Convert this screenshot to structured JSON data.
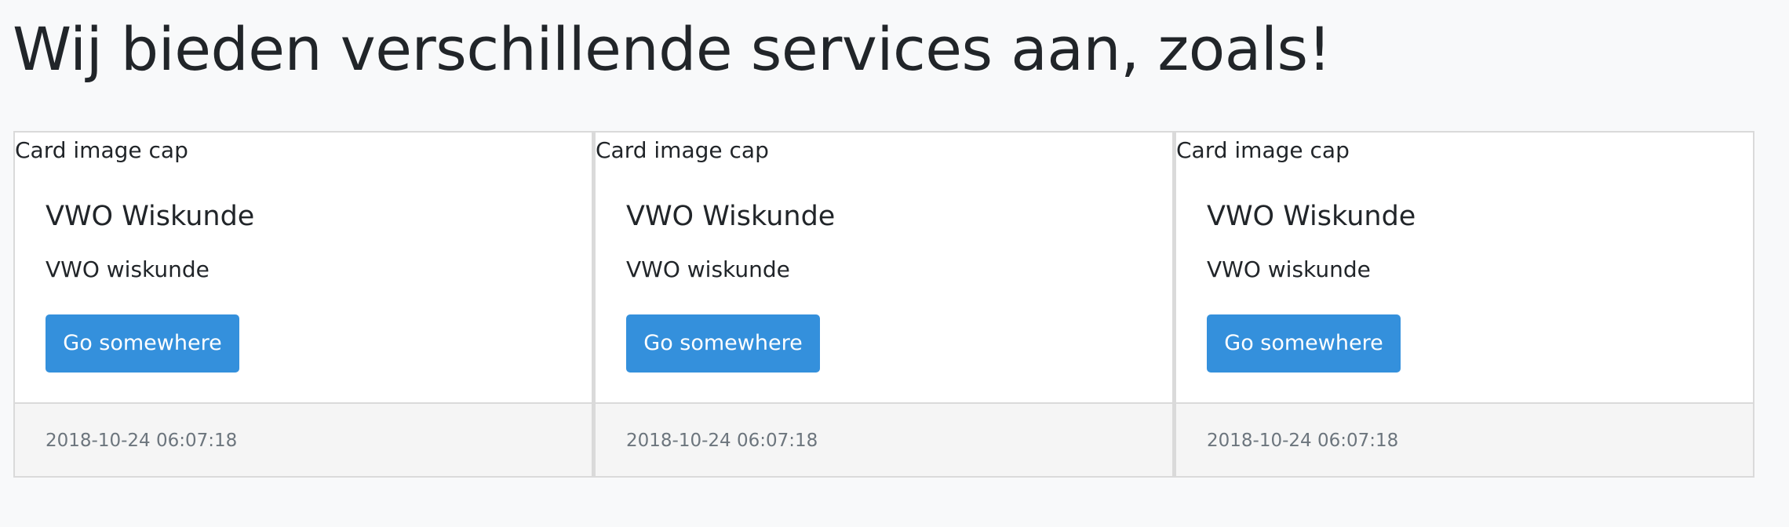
{
  "page": {
    "title": "Wij bieden verschillende services aan, zoals!"
  },
  "cards": [
    {
      "image_alt": "Card image cap",
      "title": "VWO Wiskunde",
      "text": "VWO wiskunde",
      "button_label": "Go somewhere",
      "footer_timestamp": "2018-10-24 06:07:18"
    },
    {
      "image_alt": "Card image cap",
      "title": "VWO Wiskunde",
      "text": "VWO wiskunde",
      "button_label": "Go somewhere",
      "footer_timestamp": "2018-10-24 06:07:18"
    },
    {
      "image_alt": "Card image cap",
      "title": "VWO Wiskunde",
      "text": "VWO wiskunde",
      "button_label": "Go somewhere",
      "footer_timestamp": "2018-10-24 06:07:18"
    }
  ],
  "colors": {
    "background": "#f8f9fa",
    "card_background": "#ffffff",
    "card_border": "#dadada",
    "button": "#3490dc",
    "button_text": "#ffffff",
    "footer_background": "#f5f5f5",
    "muted_text": "#6c757d"
  }
}
